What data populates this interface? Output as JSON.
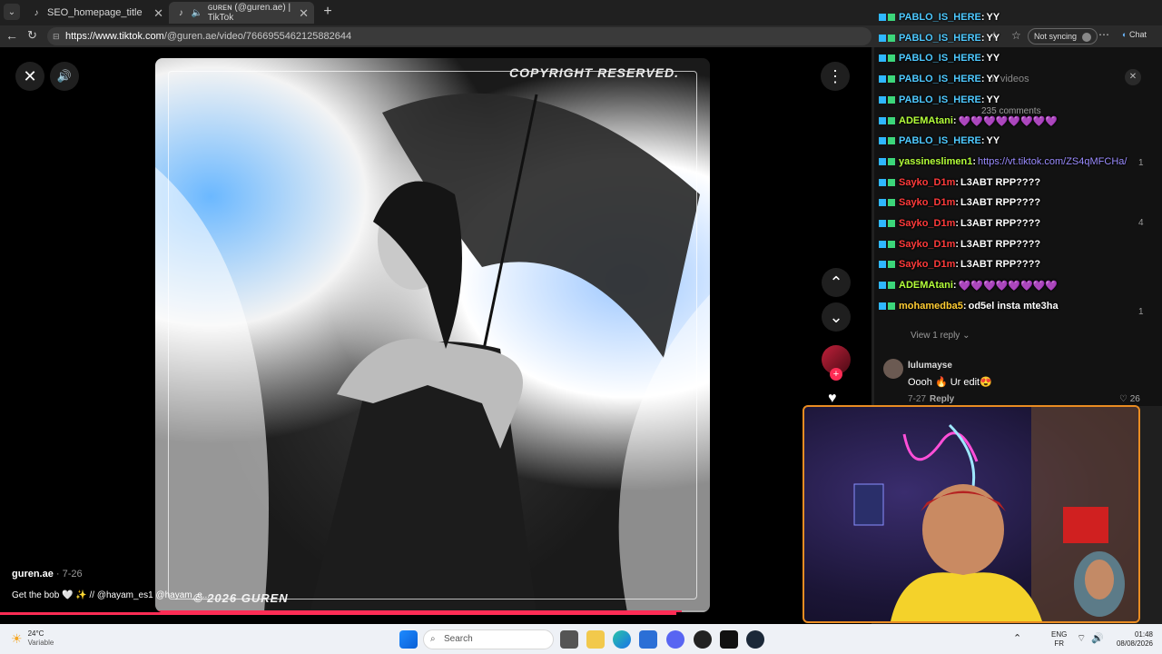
{
  "browser": {
    "tabs": [
      {
        "title": "SEO_homepage_title",
        "active": false
      },
      {
        "title": "ɢᴜʀᴇɴ (@guren.ae) | TikTok",
        "active": true
      }
    ],
    "url_domain": "https://www.tiktok.com",
    "url_path": "/@guren.ae/video/7666955462125882644",
    "sync_label": "Not syncing",
    "chat_label": "Chat"
  },
  "video": {
    "overlay_top": "COPYRIGHT RESERVED.",
    "overlay_bottom": "© 2026 GUREN",
    "author": "guren.ae",
    "date": "7-26",
    "caption": "Get the bob 🤍 ✨ // @hayam_es1 @hayam_e..."
  },
  "comments_panel": {
    "search_hint": "or videos",
    "comment_count": "235 comments",
    "view_replies": "View 1 reply",
    "commenter": "lulumayse",
    "comment_text": "Oooh 🔥 Ur edit😍",
    "comment_date": "7-27",
    "reply_label": "Reply",
    "like_count": "26",
    "like_1": "1",
    "like_2": "4",
    "like_3": "1"
  },
  "chat_messages": [
    {
      "user": "PABLO_IS_HERE",
      "text": "YY",
      "color": "#4ec9ff"
    },
    {
      "user": "PABLO_IS_HERE",
      "text": "YY",
      "color": "#4ec9ff"
    },
    {
      "user": "PABLO_IS_HERE",
      "text": "YY",
      "color": "#4ec9ff"
    },
    {
      "user": "PABLO_IS_HERE",
      "text": "YY",
      "color": "#4ec9ff"
    },
    {
      "user": "PABLO_IS_HERE",
      "text": "YY",
      "color": "#4ec9ff"
    },
    {
      "user": "ADEMAtani",
      "text": "💜💜💜💜💜💜💜💜",
      "color": "#b4ff3a"
    },
    {
      "user": "PABLO_IS_HERE",
      "text": "YY",
      "color": "#4ec9ff"
    },
    {
      "user": "yassineslimen1",
      "text": "https://vt.tiktok.com/ZS4qMFCHa/",
      "color": "#b4ff3a",
      "is_link": true
    },
    {
      "user": "Sayko_D1m",
      "text": "L3ABT RPP????",
      "color": "#ff3b3b"
    },
    {
      "user": "Sayko_D1m",
      "text": "L3ABT RPP????",
      "color": "#ff3b3b"
    },
    {
      "user": "Sayko_D1m",
      "text": "L3ABT RPP????",
      "color": "#ff3b3b"
    },
    {
      "user": "Sayko_D1m",
      "text": "L3ABT RPP????",
      "color": "#ff3b3b"
    },
    {
      "user": "Sayko_D1m",
      "text": "L3ABT RPP????",
      "color": "#ff3b3b"
    },
    {
      "user": "ADEMAtani",
      "text": "💜💜💜💜💜💜💜💜",
      "color": "#b4ff3a"
    },
    {
      "user": "mohamedba5",
      "text": "od5el insta mte3ha",
      "color": "#ffcc33"
    }
  ],
  "taskbar": {
    "temperature": "24°C",
    "weather": "Variable",
    "search_placeholder": "Search",
    "lang_top": "ENG",
    "lang_bottom": "FR",
    "time": "01:48",
    "date": "08/08/2026"
  }
}
